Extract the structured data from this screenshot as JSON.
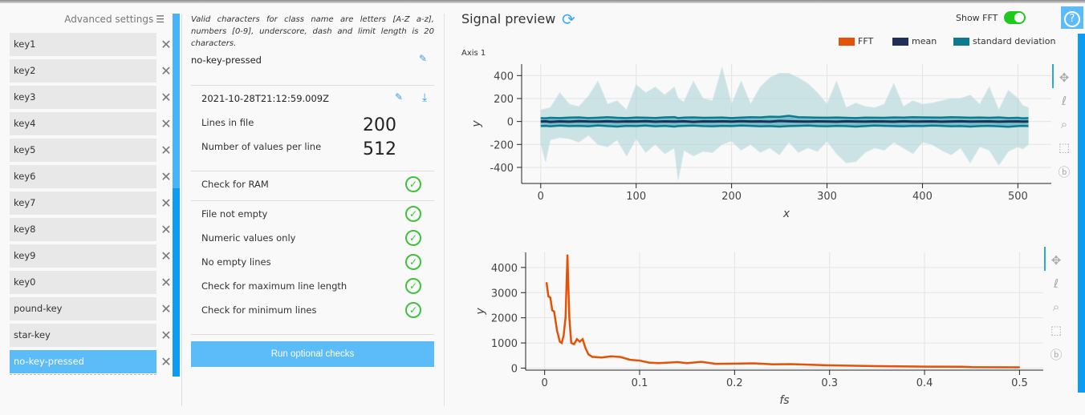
{
  "sidebar": {
    "advanced_settings": "Advanced settings",
    "advanced_icon": "sliders-icon",
    "keys": [
      "key1",
      "key2",
      "key3",
      "key4",
      "key5",
      "key6",
      "key7",
      "key8",
      "key9",
      "key0",
      "pound-key",
      "star-key",
      "no-key-pressed"
    ],
    "selected": "no-key-pressed",
    "remove_icon": "close-icon"
  },
  "details": {
    "info": "Valid characters for class name are letters [A-Z a-z], numbers [0-9], underscore, dash and limit length is 20 characters.",
    "class_name": "no-key-pressed",
    "timestamp": "2021-10-28T21:12:59.009Z",
    "lines_label": "Lines in file",
    "lines_value": "200",
    "values_label": "Number of values per line",
    "values_value": "512",
    "checks": [
      "Check for RAM",
      "File not empty",
      "Numeric values only",
      "No empty lines",
      "Check for maximum line length",
      "Check for minimum lines"
    ],
    "run_button": "Run optional checks"
  },
  "preview": {
    "title": "Signal preview",
    "show_fft": "Show FFT",
    "show_fft_on": true,
    "legend": [
      {
        "label": "FFT",
        "color": "#e35205"
      },
      {
        "label": "mean",
        "color": "#1f2f55"
      },
      {
        "label": "standard deviation",
        "color": "#0e7a8c"
      }
    ]
  },
  "chart_data": [
    {
      "type": "area",
      "title": "Axis 1",
      "xlabel": "x",
      "ylabel": "y",
      "xlim": [
        -20,
        535
      ],
      "ylim": [
        -540,
        500
      ],
      "xticks": [
        0,
        100,
        200,
        300,
        400,
        500
      ],
      "yticks": [
        -400,
        -200,
        0,
        200,
        400
      ],
      "grid": true,
      "x": [
        0,
        5,
        10,
        20,
        30,
        40,
        50,
        60,
        70,
        80,
        90,
        100,
        110,
        120,
        130,
        140,
        144,
        150,
        160,
        170,
        180,
        190,
        200,
        210,
        220,
        230,
        240,
        250,
        260,
        270,
        280,
        290,
        300,
        310,
        320,
        330,
        340,
        350,
        360,
        370,
        380,
        390,
        400,
        410,
        420,
        430,
        440,
        450,
        460,
        470,
        480,
        490,
        500,
        505,
        511
      ],
      "envelope_upper": [
        100,
        110,
        120,
        250,
        150,
        130,
        220,
        350,
        150,
        180,
        100,
        320,
        250,
        300,
        230,
        300,
        200,
        170,
        350,
        200,
        180,
        470,
        150,
        350,
        150,
        300,
        380,
        420,
        420,
        380,
        330,
        250,
        150,
        350,
        120,
        160,
        130,
        120,
        150,
        330,
        130,
        180,
        150,
        160,
        180,
        200,
        200,
        230,
        150,
        300,
        100,
        270,
        200,
        140,
        120
      ],
      "envelope_lower": [
        -190,
        -350,
        -160,
        -140,
        -150,
        -180,
        -120,
        -200,
        -220,
        -160,
        -300,
        -150,
        -270,
        -200,
        -280,
        -230,
        -510,
        -250,
        -300,
        -260,
        -270,
        -200,
        -170,
        -250,
        -200,
        -270,
        -230,
        -290,
        -180,
        -270,
        -230,
        -260,
        -170,
        -280,
        -360,
        -350,
        -270,
        -230,
        -250,
        -180,
        -230,
        -280,
        -180,
        -200,
        -250,
        -290,
        -230,
        -360,
        -220,
        -250,
        -380,
        -260,
        -220,
        -240,
        -200
      ],
      "mean": [
        0,
        2,
        -3,
        1,
        -2,
        3,
        0,
        -1,
        2,
        -2,
        1,
        0,
        3,
        -2,
        1,
        -1,
        0,
        2,
        -3,
        1,
        0,
        2,
        -1,
        3,
        0,
        1,
        -2,
        4,
        2,
        0,
        -1,
        1,
        0,
        -2,
        2,
        0,
        -1,
        1,
        0,
        -2,
        2,
        -1,
        0,
        1,
        -2,
        0,
        2,
        -1,
        0,
        1,
        -2,
        0,
        1,
        -1,
        0
      ],
      "std_upper": [
        30,
        28,
        32,
        30,
        34,
        36,
        30,
        33,
        38,
        32,
        30,
        35,
        33,
        31,
        36,
        38,
        30,
        34,
        36,
        32,
        33,
        35,
        30,
        34,
        38,
        36,
        42,
        40,
        50,
        38,
        36,
        34,
        33,
        35,
        32,
        30,
        34,
        33,
        32,
        36,
        34,
        38,
        36,
        35,
        34,
        38,
        36,
        33,
        35,
        32,
        36,
        30,
        32,
        28,
        30
      ],
      "std_lower": [
        -40,
        -38,
        -42,
        -36,
        -40,
        -38,
        -42,
        -35,
        -40,
        -44,
        -38,
        -40,
        -36,
        -42,
        -38,
        -44,
        -40,
        -38,
        -36,
        -40,
        -42,
        -38,
        -40,
        -36,
        -38,
        -42,
        -40,
        -44,
        -40,
        -38,
        -36,
        -40,
        -42,
        -38,
        -40,
        -44,
        -40,
        -36,
        -38,
        -40,
        -42,
        -38,
        -40,
        -36,
        -38,
        -42,
        -40,
        -44,
        -40,
        -38,
        -42,
        -46,
        -40,
        -38,
        -40
      ]
    },
    {
      "type": "line",
      "series": [
        {
          "name": "FFT"
        }
      ],
      "xlabel": "fs",
      "ylabel": "y",
      "xlim": [
        -0.02,
        0.525
      ],
      "ylim": [
        -80,
        4600
      ],
      "xticks": [
        0,
        0.1,
        0.2,
        0.3,
        0.4,
        0.5
      ],
      "yticks": [
        0,
        1000,
        2000,
        3000,
        4000
      ],
      "grid": true,
      "x": [
        0.002,
        0.004,
        0.006,
        0.008,
        0.01,
        0.013,
        0.016,
        0.018,
        0.02,
        0.022,
        0.024,
        0.026,
        0.028,
        0.031,
        0.034,
        0.037,
        0.04,
        0.043,
        0.046,
        0.05,
        0.06,
        0.07,
        0.08,
        0.09,
        0.1,
        0.11,
        0.12,
        0.14,
        0.15,
        0.165,
        0.18,
        0.2,
        0.22,
        0.24,
        0.26,
        0.3,
        0.35,
        0.4,
        0.44,
        0.45,
        0.5
      ],
      "y": [
        3400,
        2850,
        2800,
        2300,
        2250,
        1500,
        1050,
        1000,
        1300,
        2000,
        4500,
        2000,
        1000,
        950,
        1150,
        1050,
        1150,
        800,
        550,
        450,
        420,
        470,
        440,
        330,
        300,
        220,
        200,
        240,
        200,
        250,
        170,
        180,
        190,
        150,
        160,
        110,
        80,
        60,
        55,
        40,
        30
      ]
    }
  ]
}
